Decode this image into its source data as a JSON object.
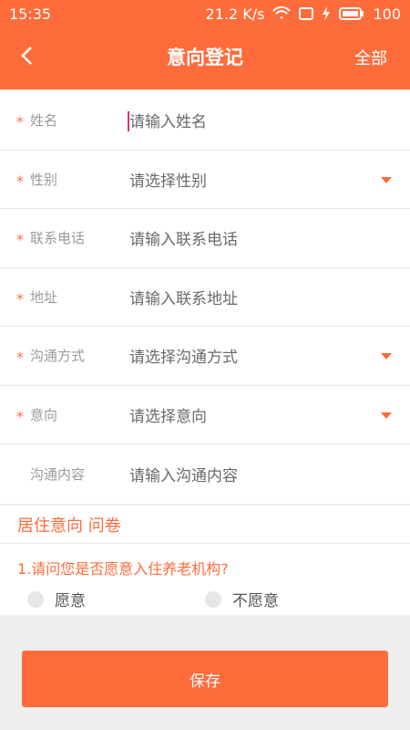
{
  "status_bar": {
    "time": "15:35",
    "speed": "21.2 K/s",
    "battery": "100"
  },
  "nav": {
    "title": "意向登记",
    "action": "全部"
  },
  "form": {
    "rows": [
      {
        "label": "姓名",
        "required": true,
        "value": "请输入姓名",
        "type": "input"
      },
      {
        "label": "性别",
        "required": true,
        "value": "请选择性别",
        "type": "select"
      },
      {
        "label": "联系电话",
        "required": true,
        "value": "请输入联系电话",
        "type": "input"
      },
      {
        "label": "地址",
        "required": true,
        "value": "请输入联系地址",
        "type": "input"
      },
      {
        "label": "沟通方式",
        "required": true,
        "value": "请选择沟通方式",
        "type": "select"
      },
      {
        "label": "意向",
        "required": true,
        "value": "请选择意向",
        "type": "select"
      },
      {
        "label": "沟通内容",
        "required": false,
        "value": "请输入沟通内容",
        "type": "input"
      }
    ],
    "required_mark": "*"
  },
  "survey": {
    "title": "居住意向 问卷",
    "question": "1.请问您是否愿意入住养老机构?",
    "options": [
      "愿意",
      "不愿意"
    ]
  },
  "save_label": "保存",
  "colors": {
    "accent": "#ff6c3c",
    "caret": "#d8356b"
  }
}
